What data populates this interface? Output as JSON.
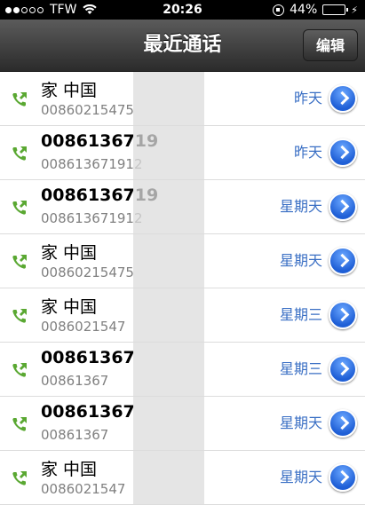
{
  "status": {
    "carrier": "TFW",
    "time": "20:26",
    "battery": "44%",
    "battery_level": 0.44
  },
  "nav": {
    "title": "最近通话",
    "edit_label": "编辑"
  },
  "calls": [
    {
      "name": "家 中国",
      "bold": false,
      "number": "00860215475",
      "day": "昨天"
    },
    {
      "name": "0086136719",
      "bold": true,
      "number": "008613671912",
      "day": "昨天"
    },
    {
      "name": "0086136719",
      "bold": true,
      "number": "008613671912",
      "day": "星期天"
    },
    {
      "name": "家 中国",
      "bold": false,
      "number": "00860215475",
      "day": "星期天"
    },
    {
      "name": "家 中国",
      "bold": false,
      "number": "0086021547",
      "day": "星期三"
    },
    {
      "name": "00861367",
      "bold": true,
      "number": "00861367",
      "day": "星期三"
    },
    {
      "name": "00861367",
      "bold": true,
      "number": "00861367",
      "day": "星期天"
    },
    {
      "name": "家 中国",
      "bold": false,
      "number": "0086021547",
      "day": "星期天"
    }
  ]
}
